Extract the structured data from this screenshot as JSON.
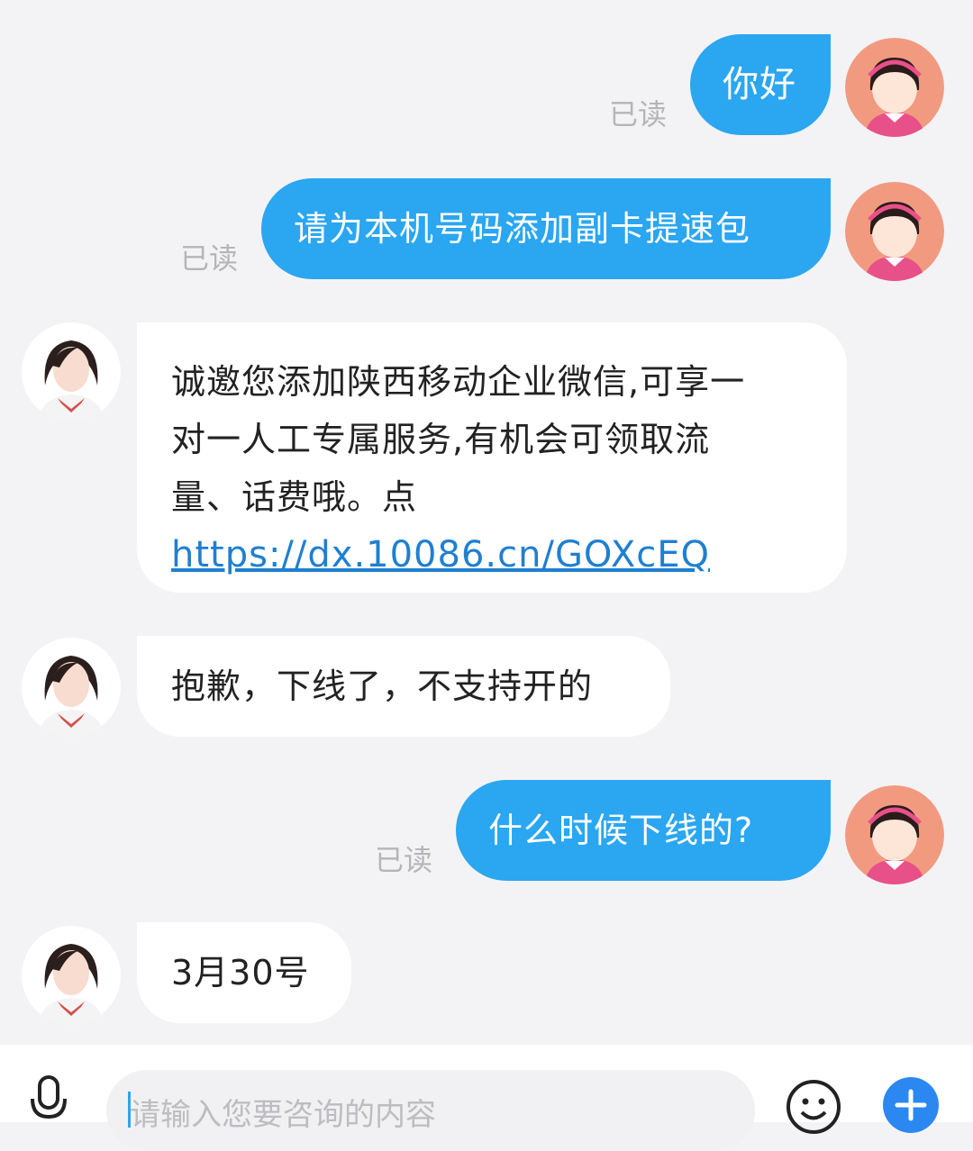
{
  "messages": [
    {
      "side": "out",
      "text": "你好",
      "status": "已读"
    },
    {
      "side": "out",
      "text": "请为本机号码添加副卡提速包",
      "status": "已读"
    },
    {
      "side": "in",
      "text_lines": [
        "诚邀您添加陕西移动企业微信,可享一",
        "对一人工专属服务,有机会可领取流",
        "量、话费哦。点"
      ],
      "link": "https://dx.10086.cn/GOXcEQ"
    },
    {
      "side": "in",
      "text": "抱歉，下线了，不支持开的"
    },
    {
      "side": "out",
      "text": "什么时候下线的?",
      "status": "已读"
    },
    {
      "side": "in",
      "text": "3月30号"
    }
  ],
  "input": {
    "placeholder": "请输入您要咨询的内容"
  },
  "icons": {
    "voice": "microphone-icon",
    "emoji": "emoji-icon",
    "add": "plus-icon"
  },
  "colors": {
    "outgoing_bubble": "#2ba6f0",
    "incoming_bubble": "#ffffff",
    "background": "#f3f3f5",
    "link": "#1f7fd1"
  }
}
